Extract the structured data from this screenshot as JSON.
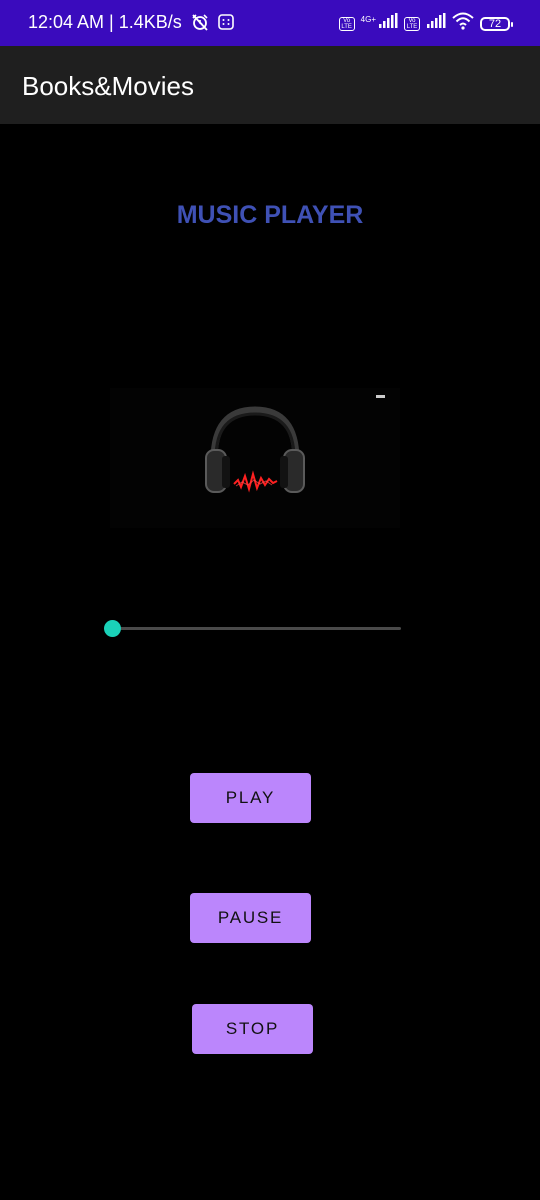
{
  "status_bar": {
    "time": "12:04 AM | 1.4KB/s",
    "network_label": "4G+",
    "battery": "72",
    "color": "#3a0bbd",
    "icons": [
      "alarm-off-icon",
      "app-notification-icon",
      "volte-icon",
      "signal-icon",
      "volte-icon",
      "signal-icon",
      "wifi-icon",
      "battery-icon"
    ]
  },
  "app_bar": {
    "title": "Books&Movies",
    "color": "#1f1f1f"
  },
  "main": {
    "heading": "MUSIC PLAYER",
    "heading_color": "#3f51b5",
    "artwork_icon": "headphones-icon",
    "seek": {
      "progress": 0,
      "thumb_color": "#1ad1b8"
    },
    "buttons": {
      "play": "PLAY",
      "pause": "PAUSE",
      "stop": "STOP",
      "color": "#bb86fc"
    }
  }
}
